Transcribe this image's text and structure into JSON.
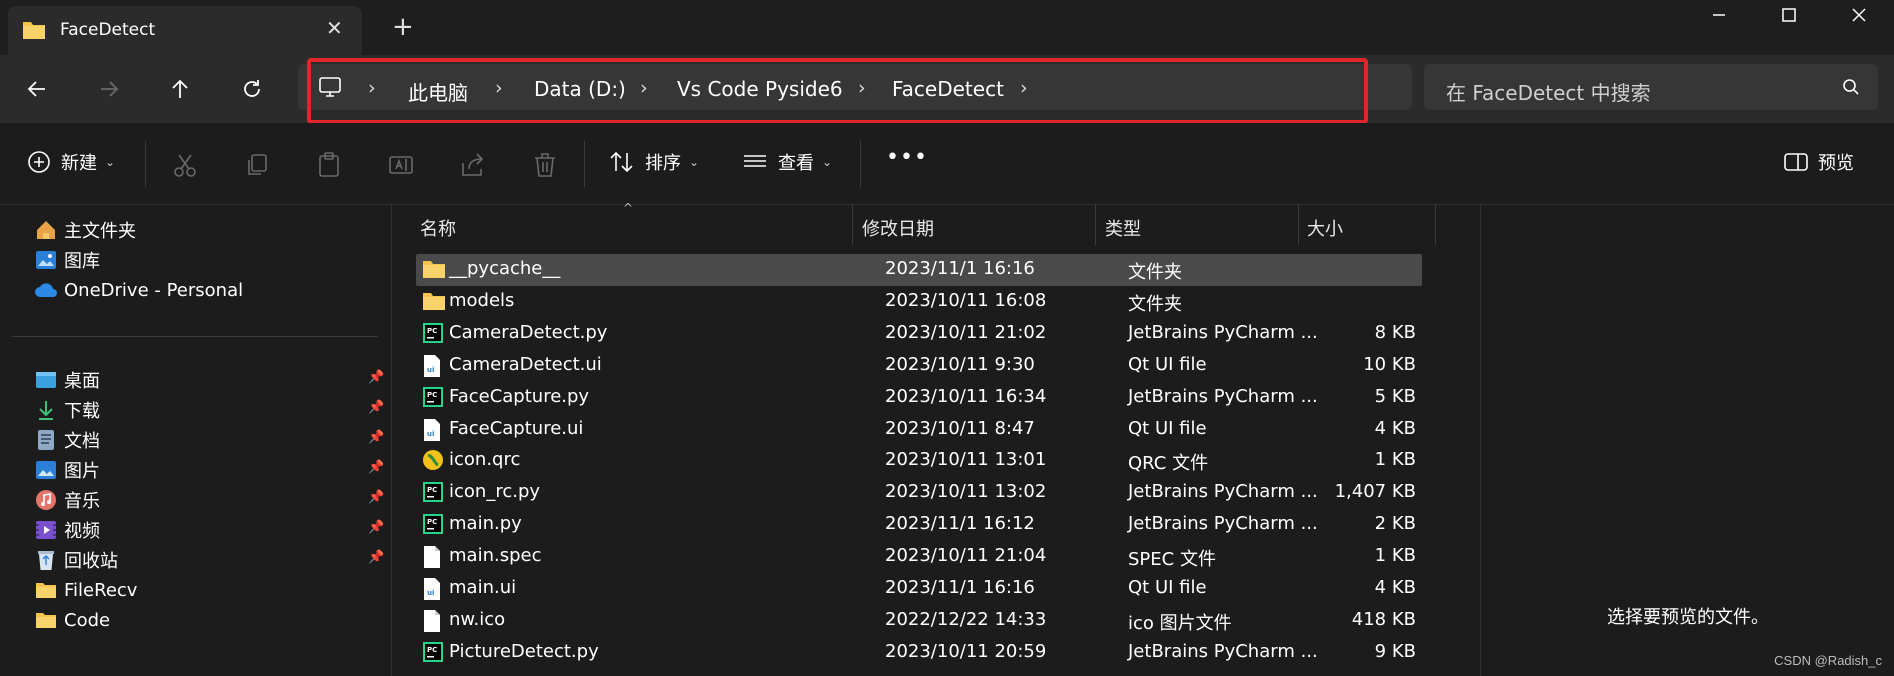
{
  "tab": {
    "title": "FaceDetect",
    "close_glyph": "✕",
    "new_tab_glyph": "+"
  },
  "window_controls": {
    "minimize": "—",
    "maximize": "☐",
    "close": "✕"
  },
  "breadcrumb": {
    "items": [
      "此电脑",
      "Data (D:)",
      "Vs Code Pyside6",
      "FaceDetect"
    ],
    "separator": "›"
  },
  "search": {
    "placeholder": "在 FaceDetect 中搜索"
  },
  "toolbar": {
    "new_label": "新建",
    "sort_label": "排序",
    "view_label": "查看",
    "more_label": "•••",
    "preview_label": "预览"
  },
  "sidebar": {
    "top": [
      {
        "label": "主文件夹",
        "icon": "home-icon"
      },
      {
        "label": "图库",
        "icon": "gallery-icon"
      },
      {
        "label": "OneDrive - Personal",
        "icon": "cloud-icon"
      }
    ],
    "pinned": [
      {
        "label": "桌面",
        "icon": "desktop-icon",
        "pinned": true
      },
      {
        "label": "下载",
        "icon": "download-icon",
        "pinned": true
      },
      {
        "label": "文档",
        "icon": "document-icon",
        "pinned": true
      },
      {
        "label": "图片",
        "icon": "pictures-icon",
        "pinned": true
      },
      {
        "label": "音乐",
        "icon": "music-icon",
        "pinned": true
      },
      {
        "label": "视频",
        "icon": "video-icon",
        "pinned": true
      },
      {
        "label": "回收站",
        "icon": "recycle-bin-icon",
        "pinned": true
      },
      {
        "label": "FileRecv",
        "icon": "folder-icon",
        "pinned": false
      },
      {
        "label": "Code",
        "icon": "folder-icon",
        "pinned": false
      }
    ]
  },
  "columns": {
    "name": "名称",
    "modified": "修改日期",
    "type": "类型",
    "size": "大小"
  },
  "files": [
    {
      "name": "__pycache__",
      "modified": "2023/11/1 16:16",
      "type": "文件夹",
      "size": "",
      "icon": "folder"
    },
    {
      "name": "models",
      "modified": "2023/10/11 16:08",
      "type": "文件夹",
      "size": "",
      "icon": "folder"
    },
    {
      "name": "CameraDetect.py",
      "modified": "2023/10/11 21:02",
      "type": "JetBrains PyCharm ...",
      "size": "8 KB",
      "icon": "pycharm"
    },
    {
      "name": "CameraDetect.ui",
      "modified": "2023/10/11 9:30",
      "type": "Qt UI file",
      "size": "10 KB",
      "icon": "ui"
    },
    {
      "name": "FaceCapture.py",
      "modified": "2023/10/11 16:34",
      "type": "JetBrains PyCharm ...",
      "size": "5 KB",
      "icon": "pycharm"
    },
    {
      "name": "FaceCapture.ui",
      "modified": "2023/10/11 8:47",
      "type": "Qt UI file",
      "size": "4 KB",
      "icon": "ui"
    },
    {
      "name": "icon.qrc",
      "modified": "2023/10/11 13:01",
      "type": "QRC 文件",
      "size": "1 KB",
      "icon": "qrc"
    },
    {
      "name": "icon_rc.py",
      "modified": "2023/10/11 13:02",
      "type": "JetBrains PyCharm ...",
      "size": "1,407 KB",
      "icon": "pycharm"
    },
    {
      "name": "main.py",
      "modified": "2023/11/1 16:12",
      "type": "JetBrains PyCharm ...",
      "size": "2 KB",
      "icon": "pycharm"
    },
    {
      "name": "main.spec",
      "modified": "2023/10/11 21:04",
      "type": "SPEC 文件",
      "size": "1 KB",
      "icon": "file"
    },
    {
      "name": "main.ui",
      "modified": "2023/11/1 16:16",
      "type": "Qt UI file",
      "size": "4 KB",
      "icon": "ui"
    },
    {
      "name": "nw.ico",
      "modified": "2022/12/22 14:33",
      "type": "ico 图片文件",
      "size": "418 KB",
      "icon": "file"
    },
    {
      "name": "PictureDetect.py",
      "modified": "2023/10/11 20:59",
      "type": "JetBrains PyCharm ...",
      "size": "9 KB",
      "icon": "pycharm"
    }
  ],
  "preview": {
    "message": "选择要预览的文件。"
  },
  "watermark": "CSDN @Radish_c",
  "colors": {
    "highlight": "#e0262a",
    "folder": "#f3c34a",
    "selection": "#4a4a4a"
  }
}
